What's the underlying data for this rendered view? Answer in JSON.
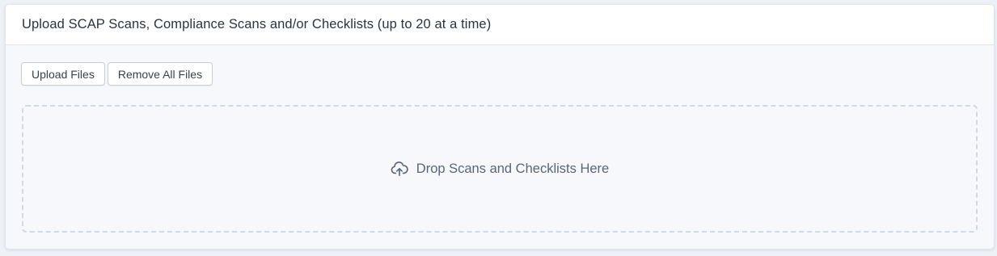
{
  "panel": {
    "title": "Upload SCAP Scans, Compliance Scans and/or Checklists (up to 20 at a time)"
  },
  "toolbar": {
    "upload_label": "Upload Files",
    "remove_all_label": "Remove All Files"
  },
  "dropzone": {
    "icon": "cloud-upload-icon",
    "text": "Drop Scans and Checklists Here"
  },
  "colors": {
    "page_background": "#eef1f6",
    "panel_background": "#f6f8fc",
    "header_background": "#ffffff",
    "dropzone_border": "#d3d9e2",
    "text_primary": "#2d333d",
    "text_muted": "#5b6573"
  }
}
